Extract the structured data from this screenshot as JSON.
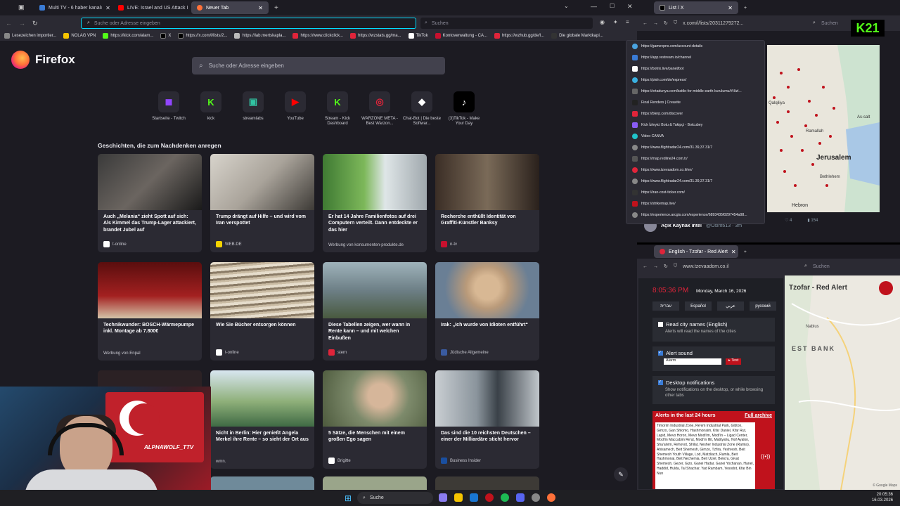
{
  "main": {
    "tabs": [
      {
        "label": "Multi TV - 6 haber kanalı",
        "color": "#3a7bd5"
      },
      {
        "label": "LIVE: Israel and US Attack I",
        "color": "#ff0000"
      },
      {
        "label": "Neuer Tab",
        "color": "#ff7139"
      }
    ],
    "url_placeholder": "Suche oder Adresse eingeben",
    "search_placeholder": "Suchen",
    "bookmarks": [
      "Lesezeichen importier...",
      "NOLAG VPN",
      "https://kick.com/alam...",
      "X",
      "https://x.com/i/lists/2...",
      "https://lab.mertskapla...",
      "https://www.clickclick...",
      "https://wzstats.gg/ma...",
      "TikTok",
      "Kontoverwaltung - CA...",
      "https://wzhub.gg/de/l...",
      "Die globale Marktkapi..."
    ],
    "brand": "Firefox",
    "newtab_search_placeholder": "Suche oder Adresse eingeben",
    "shortcuts": [
      {
        "label": "Startseite - Twitch",
        "glyph": "◼",
        "color": "#9146ff"
      },
      {
        "label": "kick",
        "glyph": "K",
        "color": "#53fc18"
      },
      {
        "label": "streamlabs",
        "glyph": "▣",
        "color": "#31c3a2"
      },
      {
        "label": "YouTube",
        "glyph": "▶",
        "color": "#ff0000"
      },
      {
        "label": "Stream - Kick Dashboard",
        "glyph": "K",
        "color": "#53fc18"
      },
      {
        "label": "WARZONE META - Best Warzon...",
        "glyph": "◎",
        "color": "#e0243a"
      },
      {
        "label": "Chat-Bot | Die beste Softwar...",
        "glyph": "◆",
        "color": "#ffffff"
      },
      {
        "label": "(3)TikTok - Make Your Day",
        "glyph": "♪",
        "color": "#ffffff"
      }
    ],
    "section_title": "Geschichten, die zum Nachdenken anregen",
    "cards": [
      {
        "title": "Auch „Melania“ zieht Spott auf sich: Als Kimmel das Trump-Lager attackiert, brandet Jubel auf",
        "source": "t-online",
        "img": "#6b6560"
      },
      {
        "title": "Trump drängt auf Hilfe – und wird vom Iran verspottet",
        "source": "WEB.DE",
        "img": "#a9a39a"
      },
      {
        "title": "Er hat 14 Jahre Familienfotos auf drei Computern verteilt. Dann entdeckte er das hier",
        "source": "Werbung von konsumenten-produkte.de",
        "img": "#5d9a4b"
      },
      {
        "title": "Recherche enthüllt Identität von Graffiti-Künstler Banksy",
        "source": "n-tv",
        "img": "#5a4a3e"
      },
      {
        "title": "Technikwunder: BOSCH-Wärmepumpe inkl. Montage ab 7.800€",
        "source": "Werbung von Enpal",
        "img": "#8a1a1a"
      },
      {
        "title": "Wie Sie Bücher entsorgen können",
        "source": "t-online",
        "img": "#9b8f80"
      },
      {
        "title": "Diese Tabellen zeigen, wer wann in Rente kann – und mit welchen Einbußen",
        "source": "stern",
        "img": "#6d7f86"
      },
      {
        "title": "Irak: „Ich wurde von Idioten entführt“",
        "source": "Jüdische Allgemeine",
        "img": "#b99a7a"
      },
      {
        "title": "",
        "source": "",
        "img": "#3b2f2f"
      },
      {
        "title": "Nicht in Berlin: Hier genießt Angela Merkel ihre Rente – so sieht der Ort aus",
        "source": "wmn.",
        "img": "#6f9a5a"
      },
      {
        "title": "5 Sätze, die Menschen mit einem großen Ego sagen",
        "source": "Brigitte",
        "img": "#7d8a6b"
      },
      {
        "title": "Das sind die 10 reichsten Deutschen – einer der Milliardäre sticht hervor",
        "source": "Business Insider",
        "img": "#5c6670"
      }
    ]
  },
  "webcam": {
    "overlay_text": "ALPHAWOLF_TTV"
  },
  "history_window": {
    "tab_label": "List / X",
    "url": "x.com/i/lists/20311279272...",
    "search_placeholder": "Suchen",
    "dropdown_items": [
      "https://gamevpns.com/account-details",
      "https://app.restream.io/channel",
      "https://botrix.live/panel/bot",
      "https://pixlr.com/de/express/",
      "https://ortadunya.com/battle-for-middle-earth-kurulumu/#Hizl...",
      "Final Renders | Creavite",
      "https://blerp.com/discover",
      "Kick İzleyici Botu & Takipçi - Botcubey",
      "Video CANVA",
      "https://www.flightradar24.com/31.39,37.31/7",
      "https://map.redline24.com.tr/",
      "https://www.tzevaadom.co.il/en/",
      "https://www.flightradar24.com/31.39,37.31/7",
      "https://iran-cost-ticker.com/",
      "https://strikemap.live/",
      "https://experience.arcgis.com/experience/6893435f0297454a98..."
    ],
    "map_labels": [
      "Jerusalem",
      "Ramallah",
      "Qalqiliya",
      "Bethlehem",
      "Hebron",
      "As-salt"
    ],
    "tweet_author": "Açık Kaynak İntel",
    "tweet_handle": "@Osint613 · 3m",
    "kick_badge": "K21",
    "like_count": "4",
    "view_count": "154"
  },
  "tzeva_window": {
    "tab_label": "English - Tzofar - Red Alert",
    "url": "www.tzevaadom.co.il",
    "search_placeholder": "Suchen",
    "time": "8:05:36 PM",
    "date": "Monday, March 16, 2026",
    "languages": [
      "עברית",
      "Español",
      "عربي",
      "русский"
    ],
    "read_city_names": "Read city names (English)",
    "read_city_desc": "Alerts will read the names of the cities",
    "alert_sound": "Alert sound",
    "alert_select": "Alarm",
    "test_button": "Test",
    "desktop_notifications": "Desktop notifications",
    "desktop_desc": "Show notifications on the desktop, or while browsing other tabs",
    "alerts_title": "Alerts in the last 24 hours",
    "full_archive": "Full archive",
    "alerts_text": "Timorim Industrial Zone, Re'em Industrial Park, Gibton, Gimzo, Gan Shlomo, Hashmonaim, Kfar Daniel, Kfar Rut, Lapid, Mevo Horon, Mevo Modi'im, Modi'in – Ligad Center, Modi'in Maccabim Re'ut, Modi'in Illit, Matityahu, Nof Ayalon, Sha'alvim, Rehovot, Shilat, Nesher Industrial Zone (Ramla), Ahisamech, Beit Shemesh, Gimzo, Tzfira, Yeshresh, Beit Shemesh Youth Village, Lod, Matzliach, Ramla, Beit Hashmonai, Beit Nechemia, Beit Uziel, Beko'a, Givat Shemesh, Gezer, Gizo, Ganei Hadar, Ganei Yochanan, Hanel, Haddid, Hulda, Tal Shachar, Yad Rambam, Yesodot, Kfar Bin Nun",
    "logo_text": "Tzofar - Red Alert",
    "map_labels": [
      "EST BANK",
      "Nablus"
    ],
    "google": "© Google Maps"
  },
  "taskbar": {
    "search_label": "Suche",
    "time": "20:05:36",
    "date": "16.03.2026"
  }
}
